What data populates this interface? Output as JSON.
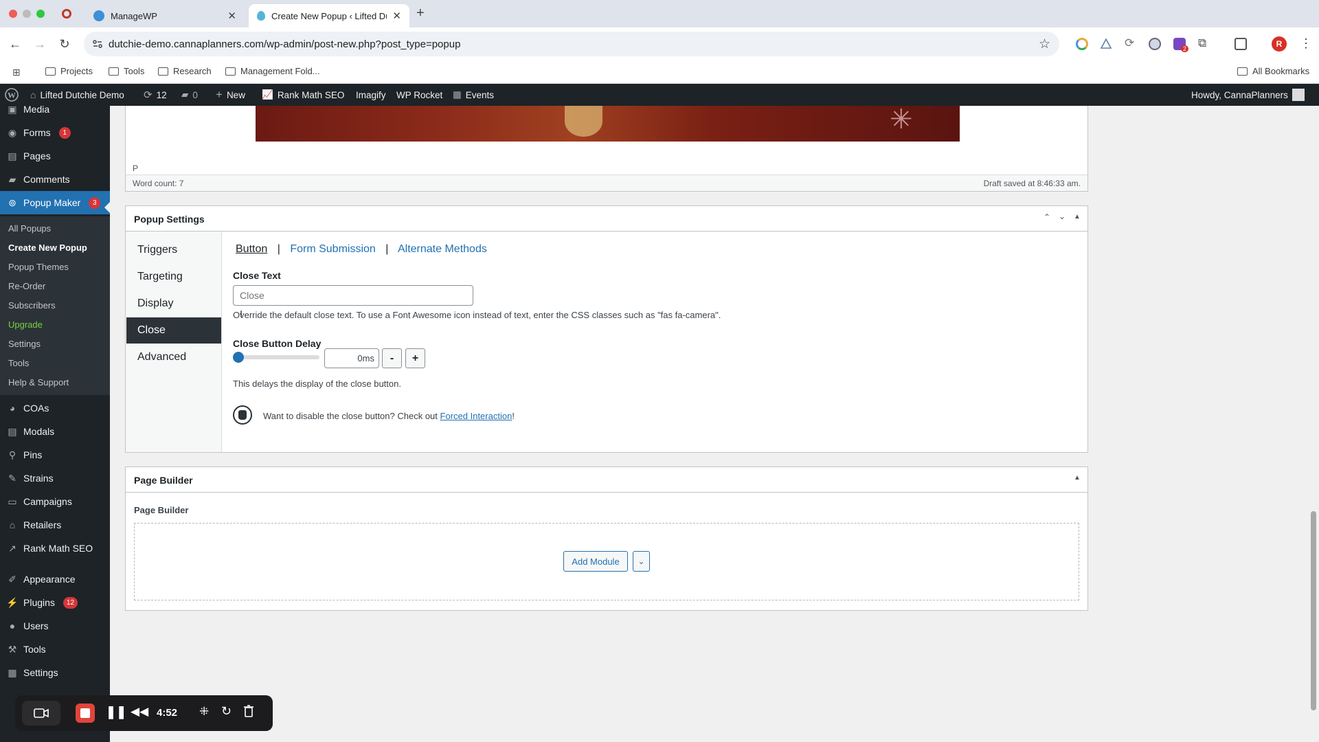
{
  "browser": {
    "tabs": [
      {
        "title": "ManageWP",
        "active": false
      },
      {
        "title": "Create New Popup ‹ Lifted Du",
        "active": true
      }
    ],
    "url": "dutchie-demo.cannaplanners.com/wp-admin/post-new.php?post_type=popup",
    "profile_initial": "R",
    "extension_badge": "2",
    "bookmarks": [
      "Projects",
      "Tools",
      "Research",
      "Management Fold..."
    ],
    "all_bookmarks": "All Bookmarks"
  },
  "adminbar": {
    "site": "Lifted Dutchie Demo",
    "updates": "12",
    "comments": "0",
    "new": "New",
    "items": [
      "Rank Math SEO",
      "Imagify",
      "WP Rocket",
      "Events"
    ],
    "howdy": "Howdy, CannaPlanners"
  },
  "menu": {
    "top": [
      {
        "label": "Media",
        "icon": "media-icon"
      },
      {
        "label": "Forms",
        "icon": "forms-icon",
        "badge": "1"
      },
      {
        "label": "Pages",
        "icon": "pages-icon"
      },
      {
        "label": "Comments",
        "icon": "comments-icon"
      },
      {
        "label": "Popup Maker",
        "icon": "popup-icon",
        "badge": "3"
      }
    ],
    "submenu": [
      "All Popups",
      "Create New Popup",
      "Popup Themes",
      "Re-Order",
      "Subscribers",
      "Upgrade",
      "Settings",
      "Tools",
      "Help & Support"
    ],
    "bottom": [
      {
        "label": "COAs",
        "icon": "coas-icon"
      },
      {
        "label": "Modals",
        "icon": "modals-icon"
      },
      {
        "label": "Pins",
        "icon": "pins-icon"
      },
      {
        "label": "Strains",
        "icon": "strains-icon"
      },
      {
        "label": "Campaigns",
        "icon": "campaigns-icon"
      },
      {
        "label": "Retailers",
        "icon": "retailers-icon"
      },
      {
        "label": "Rank Math SEO",
        "icon": "rankmath-icon"
      },
      {
        "label": "Appearance",
        "icon": "appearance-icon"
      },
      {
        "label": "Plugins",
        "icon": "plugins-icon",
        "badge": "12"
      },
      {
        "label": "Users",
        "icon": "users-icon"
      },
      {
        "label": "Tools",
        "icon": "tools-icon"
      },
      {
        "label": "Settings",
        "icon": "settings-icon"
      }
    ]
  },
  "editor": {
    "path": "P",
    "word_count": "Word count: 7",
    "draft_saved": "Draft saved at 8:46:33 am."
  },
  "popup_settings": {
    "title": "Popup Settings",
    "tabs": [
      "Triggers",
      "Targeting",
      "Display",
      "Close",
      "Advanced"
    ],
    "active_tab": "Close",
    "subtabs": [
      "Button",
      "Form Submission",
      "Alternate Methods"
    ],
    "close_text_label": "Close Text",
    "close_text_placeholder": "Close",
    "close_text_desc": "Override the default close text. To use a Font Awesome icon instead of text, enter the CSS classes such as \"fas fa-camera\".",
    "delay_label": "Close Button Delay",
    "delay_value": "0",
    "delay_unit": "ms",
    "delay_minus": "-",
    "delay_plus": "+",
    "delay_desc": "This delays the display of the close button.",
    "notice_text": "Want to disable the close button? Check out",
    "notice_link": "Forced Interaction",
    "notice_end": "!"
  },
  "page_builder": {
    "title": "Page Builder",
    "inner_label": "Page Builder",
    "add_module": "Add Module"
  },
  "recorder": {
    "time": "4:52"
  }
}
